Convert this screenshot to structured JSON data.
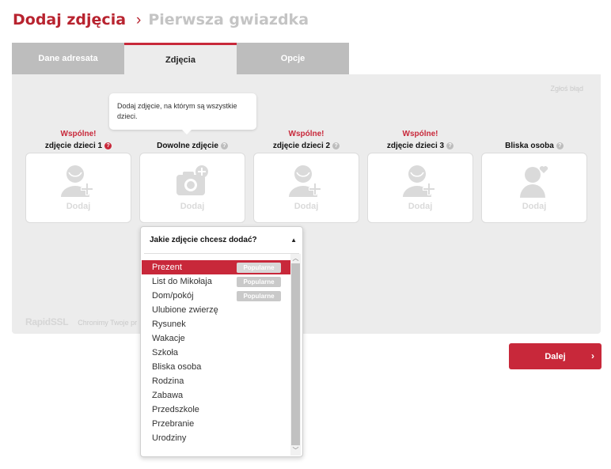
{
  "header": {
    "title": "Dodaj zdjęcia",
    "separator": "›",
    "subtitle": "Pierwsza gwiazdka"
  },
  "tabs": [
    {
      "label": "Dane adresata",
      "active": false
    },
    {
      "label": "Zdjęcia",
      "active": true
    },
    {
      "label": "Opcje",
      "active": false
    }
  ],
  "report_link": "Zgłoś błąd",
  "tooltip": "Dodaj zdjęcie, na którym są wszystkie dzieci.",
  "slots": [
    {
      "shared": "Wspólne!",
      "label": "zdjęcie dzieci 1",
      "add": "Dodaj",
      "icon": "child-add-icon"
    },
    {
      "shared": "",
      "label": "Dowolne zdjęcie",
      "add": "Dodaj",
      "icon": "camera-add-icon"
    },
    {
      "shared": "Wspólne!",
      "label": "zdjęcie dzieci 2",
      "add": "Dodaj",
      "icon": "child-add-icon"
    },
    {
      "shared": "Wspólne!",
      "label": "zdjęcie dzieci 3",
      "add": "Dodaj",
      "icon": "child-add-icon"
    },
    {
      "shared": "",
      "label": "Bliska osoba",
      "add": "Dodaj",
      "icon": "person-heart-icon"
    }
  ],
  "help_glyph": "?",
  "ssl": {
    "logo": "RapidSSL",
    "text": "Chronimy Twoje pr"
  },
  "next_button": {
    "label": "Dalej",
    "chevron": "›"
  },
  "dropdown": {
    "title": "Jakie zdjęcie chcesz dodać?",
    "caret": "▲",
    "items": [
      {
        "label": "Prezent",
        "badge": "Popularne",
        "selected": true
      },
      {
        "label": "List do Mikołaja",
        "badge": "Popularne"
      },
      {
        "label": "Dom/pokój",
        "badge": "Popularne"
      },
      {
        "label": "Ulubione zwierzę"
      },
      {
        "label": "Rysunek"
      },
      {
        "label": "Wakacje"
      },
      {
        "label": "Szkoła"
      },
      {
        "label": "Bliska osoba"
      },
      {
        "label": "Rodzina"
      },
      {
        "label": "Zabawa"
      },
      {
        "label": "Przedszkole"
      },
      {
        "label": "Przebranie"
      },
      {
        "label": "Urodziny"
      }
    ]
  },
  "colors": {
    "accent": "#c8283a",
    "panel": "#ececec",
    "tab_inactive": "#bdbdbd",
    "icon": "#dadada"
  }
}
